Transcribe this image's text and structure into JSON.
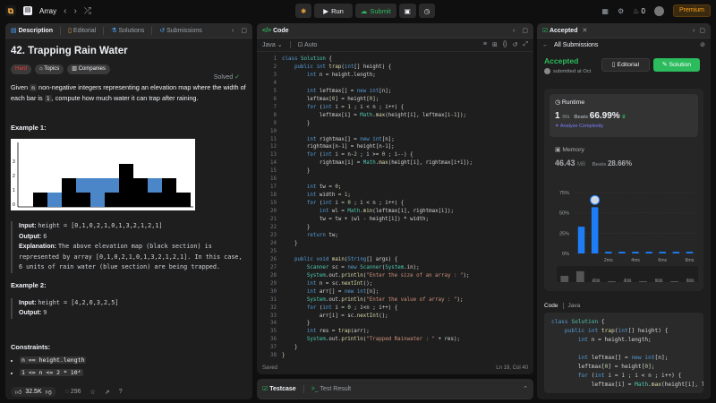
{
  "topbar": {
    "app_label": "Array",
    "run_label": "Run",
    "submit_label": "Submit",
    "streak": "0",
    "premium_label": "Premium"
  },
  "description": {
    "tabs": [
      "Description",
      "Editorial",
      "Solutions",
      "Submissions"
    ],
    "title": "42. Trapping Rain Water",
    "solved_label": "Solved",
    "difficulty": "Hard",
    "topics_label": "Topics",
    "companies_label": "Companies",
    "text_parts": [
      "Given ",
      "n",
      " non-negative integers representing an elevation map where the width of each bar is ",
      "1",
      ", compute how much water it can trap after raining."
    ],
    "example1": {
      "heading": "Example 1:",
      "input_label": "Input:",
      "input_value": "height = [0,1,0,2,1,0,1,3,2,1,2,1]",
      "output_label": "Output:",
      "output_value": "6",
      "explanation_label": "Explanation:",
      "explanation_text": "The above elevation map (black section) is represented by array [0,1,0,2,1,0,1,3,2,1,2,1]. In this case, 6 units of rain water (blue section) are being trapped."
    },
    "example2": {
      "heading": "Example 2:",
      "input_label": "Input:",
      "input_value": "height = [4,2,0,3,2,5]",
      "output_label": "Output:",
      "output_value": "9"
    },
    "constraints_heading": "Constraints:",
    "constraints": [
      "n == height.length",
      "1 <= n <= 2 * 10⁴"
    ],
    "likes": "32.5K",
    "comments": "296"
  },
  "code": {
    "tab_label": "Code",
    "language": "Java",
    "mode": "Auto",
    "status": "Saved",
    "cursor": "Ln 19, Col 40",
    "bottom_tabs": [
      "Testcase",
      "Test Result"
    ],
    "lines": [
      "class Solution {",
      "    public int trap(int[] height) {",
      "        int n = height.length;",
      "",
      "        int leftmax[] = new int[n];",
      "        leftmax[0] = height[0];",
      "        for (int i = 1 ; i < n ; i++) {",
      "            leftmax[i] = Math.max(height[i], leftmax[i-1]);",
      "        }",
      "",
      "        int rightmax[] = new int[n];",
      "        rightmax[n-1] = height[n-1];",
      "        for (int i = n-2 ; i >= 0 ; i--) {",
      "            rightmax[i] = Math.max(height[i], rightmax[i+1]);",
      "        }",
      "",
      "        int tw = 0;",
      "        int width = 1;",
      "        for (int i = 0 ; i < n ; i++) {",
      "            int wl = Math.min(leftmax[i], rightmax[i]);",
      "            tw = tw + (wl - height[i]) * width;",
      "        }",
      "        return tw;",
      "    }",
      "",
      "    public void main(String[] args) {",
      "        Scanner sc = new Scanner(System.in);",
      "        System.out.println(\"Enter the size of an array : \");",
      "        int n = sc.nextInt();",
      "        int arr[] = new int[n];",
      "        System.out.println(\"Enter the value of array : \");",
      "        for (int i = 0 ; i<n ; i++) {",
      "            arr[i] = sc.nextInt();",
      "        }",
      "        int res = trap(arr);",
      "        System.out.println(\"Trapped Rainwater : \" + res);",
      "    }",
      "}"
    ]
  },
  "accepted": {
    "tab_label": "Accepted",
    "back_label": "All Submissions",
    "status": "Accepted",
    "submitted_by": "submitted at Oct",
    "editorial_label": "Editorial",
    "solution_label": "Solution",
    "runtime_label": "Runtime",
    "runtime_value": "1",
    "runtime_unit": "ms",
    "beats_label": "Beats",
    "runtime_beats": "66.99%",
    "analyze_label": "Analyze Complexity",
    "memory_label": "Memory",
    "memory_value": "46.43",
    "memory_unit": "MB",
    "memory_beats": "28.66%",
    "code_label": "Code",
    "code_lang": "Java",
    "code_lines": [
      "class Solution {",
      "    public int trap(int[] height) {",
      "        int n = height.length;",
      "",
      "        int leftmax[] = new int[n];",
      "        leftmax[0] = height[0];",
      "        for (int i = 1 ; i < n ; i++) {",
      "            leftmax[i] = Math.max(height[i], leftmax[i-1]);"
    ]
  },
  "chart_data": {
    "type": "bar",
    "ylabel_ticks": [
      "0%",
      "25%",
      "50%",
      "75%"
    ],
    "xlabel_ticks": [
      "2ms",
      "4ms",
      "6ms",
      "8ms"
    ],
    "ylim": [
      0,
      75
    ],
    "categories": [
      "0ms",
      "1ms",
      "2ms",
      "3ms",
      "4ms",
      "5ms",
      "6ms",
      "7ms",
      "8ms"
    ],
    "values": [
      33,
      57,
      2,
      2,
      2,
      2,
      2,
      2,
      2
    ],
    "highlight_index": 1,
    "colors": {
      "bar": "#1e7cf5",
      "grid": "#3a3a3a"
    }
  }
}
